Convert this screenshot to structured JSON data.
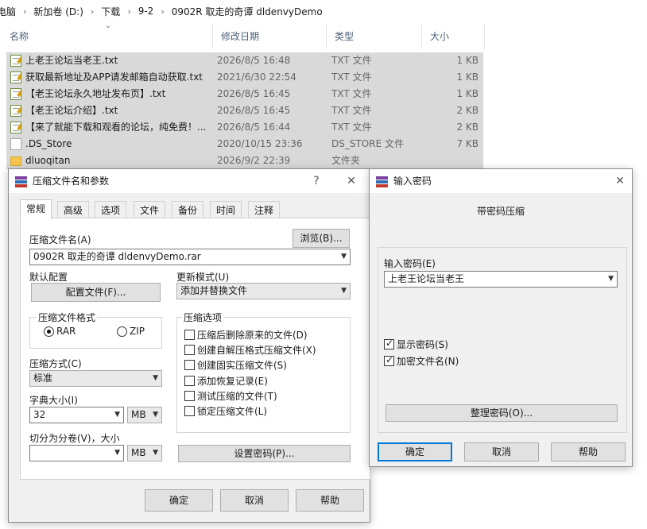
{
  "explorer": {
    "breadcrumb": [
      "电脑",
      "新加卷 (D:)",
      "下载",
      "9-2",
      "0902R 取走的奇谭 dldenvyDemo"
    ],
    "columns": {
      "name": "名称",
      "date": "修改日期",
      "type": "类型",
      "size": "大小"
    },
    "files": [
      {
        "name": "上老王论坛当老王.txt",
        "date": "2026/8/5 16:48",
        "type": "TXT 文件",
        "size": "1 KB",
        "icon": "txt-file-icon"
      },
      {
        "name": "获取最新地址及APP请发邮箱自动获取.txt",
        "date": "2021/6/30 22:54",
        "type": "TXT 文件",
        "size": "1 KB",
        "icon": "txt-file-icon"
      },
      {
        "name": "【老王论坛永久地址发布页】.txt",
        "date": "2026/8/5 16:45",
        "type": "TXT 文件",
        "size": "1 KB",
        "icon": "txt-file-icon"
      },
      {
        "name": "【老王论坛介绍】.txt",
        "date": "2026/8/5 16:45",
        "type": "TXT 文件",
        "size": "2 KB",
        "icon": "txt-file-icon"
      },
      {
        "name": "【来了就能下载和观看的论坛，纯免费！...",
        "date": "2026/8/5 16:44",
        "type": "TXT 文件",
        "size": "2 KB",
        "icon": "txt-file-icon"
      },
      {
        "name": ".DS_Store",
        "date": "2020/10/15 23:36",
        "type": "DS_STORE 文件",
        "size": "7 KB",
        "icon": "generic-file-icon"
      },
      {
        "name": "dluoqitan",
        "date": "2026/9/2 22:39",
        "type": "文件夹",
        "size": "",
        "icon": "folder-icon"
      }
    ]
  },
  "archive_dialog": {
    "title": "压缩文件名和参数",
    "help_glyph": "?",
    "close_glyph": "✕",
    "tabs": [
      "常规",
      "高级",
      "选项",
      "文件",
      "备份",
      "时间",
      "注释"
    ],
    "archive_name_label": "压缩文件名(A)",
    "archive_name_value": "0902R 取走的奇谭 dldenvyDemo.rar",
    "browse_label": "浏览(B)...",
    "default_profile_label": "默认配置",
    "profile_button": "配置文件(F)...",
    "update_mode_label": "更新模式(U)",
    "update_mode_value": "添加并替换文件",
    "format_group_label": "压缩文件格式",
    "format_rar": "RAR",
    "format_zip": "ZIP",
    "format_selected": "RAR",
    "options_group_label": "压缩选项",
    "options": [
      {
        "label": "压缩后删除原来的文件(D)",
        "checked": false
      },
      {
        "label": "创建自解压格式压缩文件(X)",
        "checked": false
      },
      {
        "label": "创建固实压缩文件(S)",
        "checked": false
      },
      {
        "label": "添加恢复记录(E)",
        "checked": false
      },
      {
        "label": "测试压缩的文件(T)",
        "checked": false
      },
      {
        "label": "锁定压缩文件(L)",
        "checked": false
      }
    ],
    "method_label": "压缩方式(C)",
    "method_value": "标准",
    "dict_label": "字典大小(I)",
    "dict_value": "32",
    "dict_unit": "MB",
    "split_label": "切分为分卷(V)，大小",
    "split_value": "",
    "split_unit": "MB",
    "set_password_button": "设置密码(P)...",
    "ok": "确定",
    "cancel": "取消",
    "help": "帮助"
  },
  "password_dialog": {
    "title": "输入密码",
    "close_glyph": "✕",
    "heading": "带密码压缩",
    "password_label": "输入密码(E)",
    "password_value": "上老王论坛当老王",
    "show_password": {
      "label": "显示密码(S)",
      "checked": true
    },
    "encrypt_names": {
      "label": "加密文件名(N)",
      "checked": true
    },
    "organize_button": "整理密码(O)...",
    "ok": "确定",
    "cancel": "取消",
    "help": "帮助"
  }
}
